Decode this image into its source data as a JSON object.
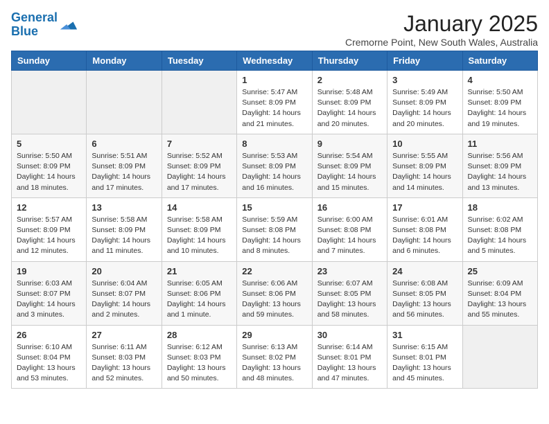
{
  "logo": {
    "line1": "General",
    "line2": "Blue"
  },
  "title": "January 2025",
  "subtitle": "Cremorne Point, New South Wales, Australia",
  "days_of_week": [
    "Sunday",
    "Monday",
    "Tuesday",
    "Wednesday",
    "Thursday",
    "Friday",
    "Saturday"
  ],
  "weeks": [
    [
      {
        "day": "",
        "info": ""
      },
      {
        "day": "",
        "info": ""
      },
      {
        "day": "",
        "info": ""
      },
      {
        "day": "1",
        "info": "Sunrise: 5:47 AM\nSunset: 8:09 PM\nDaylight: 14 hours\nand 21 minutes."
      },
      {
        "day": "2",
        "info": "Sunrise: 5:48 AM\nSunset: 8:09 PM\nDaylight: 14 hours\nand 20 minutes."
      },
      {
        "day": "3",
        "info": "Sunrise: 5:49 AM\nSunset: 8:09 PM\nDaylight: 14 hours\nand 20 minutes."
      },
      {
        "day": "4",
        "info": "Sunrise: 5:50 AM\nSunset: 8:09 PM\nDaylight: 14 hours\nand 19 minutes."
      }
    ],
    [
      {
        "day": "5",
        "info": "Sunrise: 5:50 AM\nSunset: 8:09 PM\nDaylight: 14 hours\nand 18 minutes."
      },
      {
        "day": "6",
        "info": "Sunrise: 5:51 AM\nSunset: 8:09 PM\nDaylight: 14 hours\nand 17 minutes."
      },
      {
        "day": "7",
        "info": "Sunrise: 5:52 AM\nSunset: 8:09 PM\nDaylight: 14 hours\nand 17 minutes."
      },
      {
        "day": "8",
        "info": "Sunrise: 5:53 AM\nSunset: 8:09 PM\nDaylight: 14 hours\nand 16 minutes."
      },
      {
        "day": "9",
        "info": "Sunrise: 5:54 AM\nSunset: 8:09 PM\nDaylight: 14 hours\nand 15 minutes."
      },
      {
        "day": "10",
        "info": "Sunrise: 5:55 AM\nSunset: 8:09 PM\nDaylight: 14 hours\nand 14 minutes."
      },
      {
        "day": "11",
        "info": "Sunrise: 5:56 AM\nSunset: 8:09 PM\nDaylight: 14 hours\nand 13 minutes."
      }
    ],
    [
      {
        "day": "12",
        "info": "Sunrise: 5:57 AM\nSunset: 8:09 PM\nDaylight: 14 hours\nand 12 minutes."
      },
      {
        "day": "13",
        "info": "Sunrise: 5:58 AM\nSunset: 8:09 PM\nDaylight: 14 hours\nand 11 minutes."
      },
      {
        "day": "14",
        "info": "Sunrise: 5:58 AM\nSunset: 8:09 PM\nDaylight: 14 hours\nand 10 minutes."
      },
      {
        "day": "15",
        "info": "Sunrise: 5:59 AM\nSunset: 8:08 PM\nDaylight: 14 hours\nand 8 minutes."
      },
      {
        "day": "16",
        "info": "Sunrise: 6:00 AM\nSunset: 8:08 PM\nDaylight: 14 hours\nand 7 minutes."
      },
      {
        "day": "17",
        "info": "Sunrise: 6:01 AM\nSunset: 8:08 PM\nDaylight: 14 hours\nand 6 minutes."
      },
      {
        "day": "18",
        "info": "Sunrise: 6:02 AM\nSunset: 8:08 PM\nDaylight: 14 hours\nand 5 minutes."
      }
    ],
    [
      {
        "day": "19",
        "info": "Sunrise: 6:03 AM\nSunset: 8:07 PM\nDaylight: 14 hours\nand 3 minutes."
      },
      {
        "day": "20",
        "info": "Sunrise: 6:04 AM\nSunset: 8:07 PM\nDaylight: 14 hours\nand 2 minutes."
      },
      {
        "day": "21",
        "info": "Sunrise: 6:05 AM\nSunset: 8:06 PM\nDaylight: 14 hours\nand 1 minute."
      },
      {
        "day": "22",
        "info": "Sunrise: 6:06 AM\nSunset: 8:06 PM\nDaylight: 13 hours\nand 59 minutes."
      },
      {
        "day": "23",
        "info": "Sunrise: 6:07 AM\nSunset: 8:05 PM\nDaylight: 13 hours\nand 58 minutes."
      },
      {
        "day": "24",
        "info": "Sunrise: 6:08 AM\nSunset: 8:05 PM\nDaylight: 13 hours\nand 56 minutes."
      },
      {
        "day": "25",
        "info": "Sunrise: 6:09 AM\nSunset: 8:04 PM\nDaylight: 13 hours\nand 55 minutes."
      }
    ],
    [
      {
        "day": "26",
        "info": "Sunrise: 6:10 AM\nSunset: 8:04 PM\nDaylight: 13 hours\nand 53 minutes."
      },
      {
        "day": "27",
        "info": "Sunrise: 6:11 AM\nSunset: 8:03 PM\nDaylight: 13 hours\nand 52 minutes."
      },
      {
        "day": "28",
        "info": "Sunrise: 6:12 AM\nSunset: 8:03 PM\nDaylight: 13 hours\nand 50 minutes."
      },
      {
        "day": "29",
        "info": "Sunrise: 6:13 AM\nSunset: 8:02 PM\nDaylight: 13 hours\nand 48 minutes."
      },
      {
        "day": "30",
        "info": "Sunrise: 6:14 AM\nSunset: 8:01 PM\nDaylight: 13 hours\nand 47 minutes."
      },
      {
        "day": "31",
        "info": "Sunrise: 6:15 AM\nSunset: 8:01 PM\nDaylight: 13 hours\nand 45 minutes."
      },
      {
        "day": "",
        "info": ""
      }
    ]
  ]
}
